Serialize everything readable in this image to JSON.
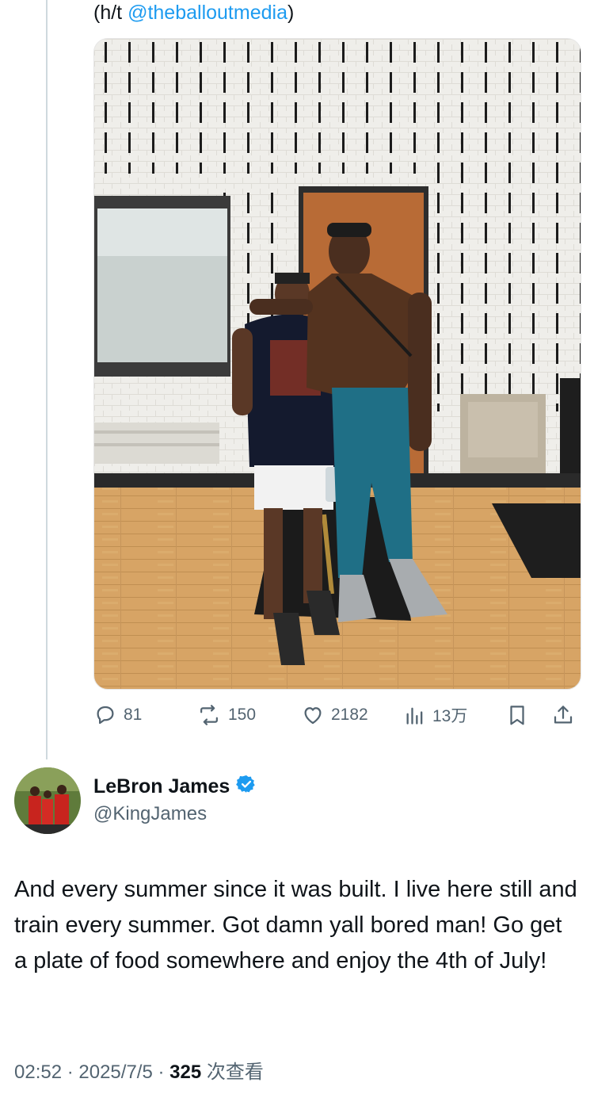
{
  "hat_tip": {
    "prefix": "(h/t ",
    "handle": "@theballoutmedia",
    "suffix": ")"
  },
  "photo": {
    "alt": ""
  },
  "actions": {
    "replies": "81",
    "reposts": "150",
    "likes": "2182",
    "views": "13万",
    "icons": [
      "reply-icon",
      "repost-icon",
      "like-icon",
      "views-icon",
      "bookmark-icon",
      "share-icon"
    ]
  },
  "author": {
    "name": "LeBron James",
    "handle": "@KingJames",
    "verified": true
  },
  "tweet": {
    "text": "And every summer since it was built. I live here still and train every summer. Got damn yall bored man! Go get a plate of food somewhere and enjoy the 4th of July!"
  },
  "meta": {
    "time": "02:52",
    "sep1": " · ",
    "date": "2025/7/5",
    "sep2": " · ",
    "views_count": "325",
    "views_label": " 次查看"
  },
  "colors": {
    "accent": "#1d9bf0",
    "muted": "#536471",
    "text": "#0f1419",
    "divider": "#cfd9de"
  }
}
